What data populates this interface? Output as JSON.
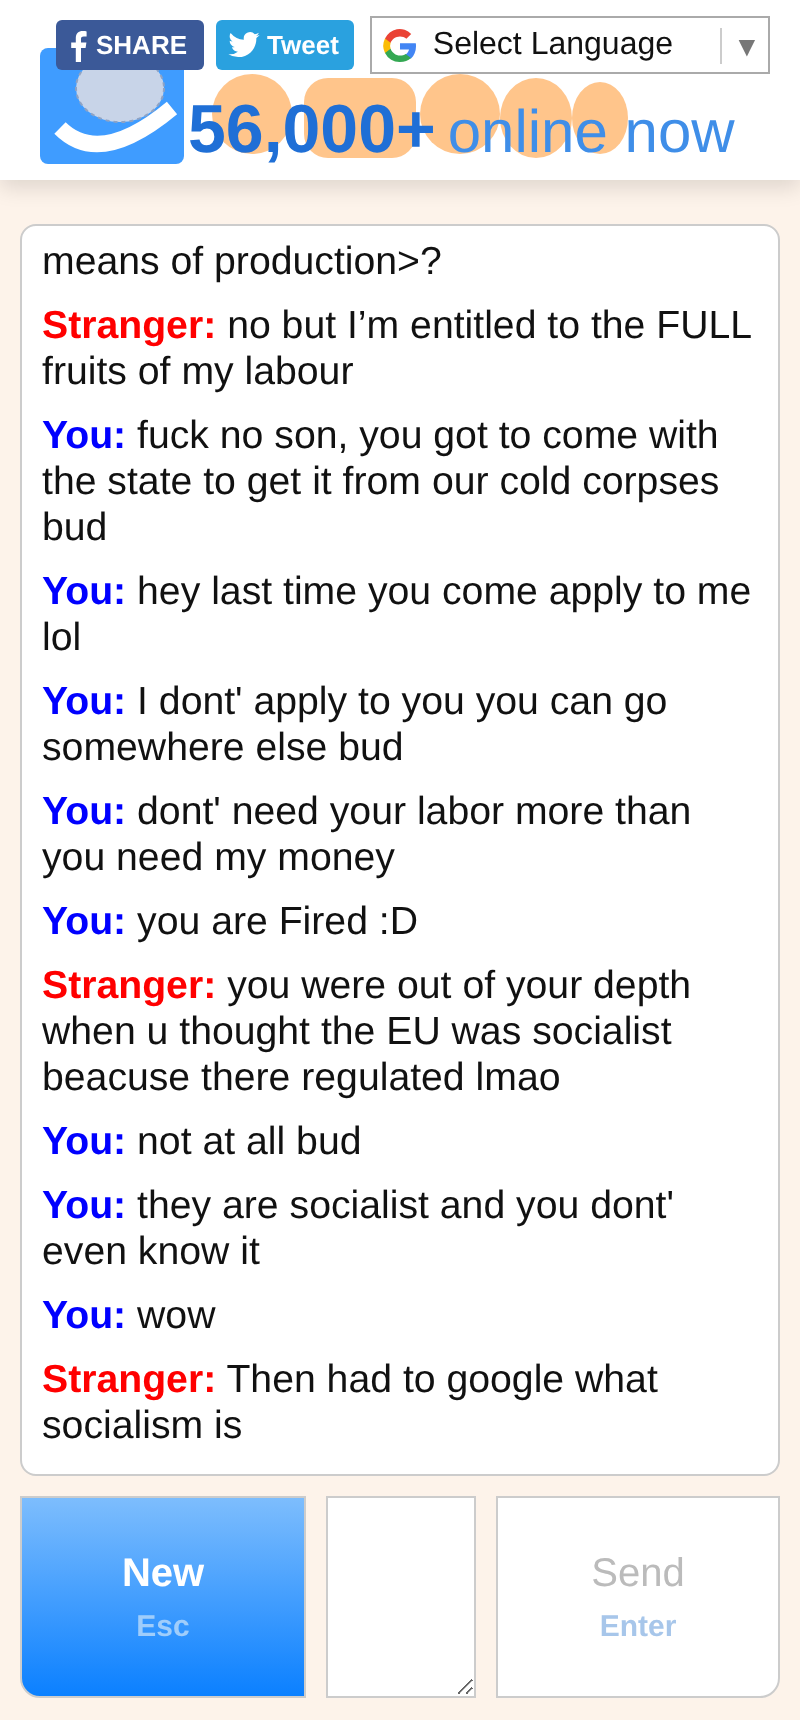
{
  "header": {
    "share_button": "SHARE",
    "tweet_button": "Tweet",
    "language_select": {
      "value": "Select Language",
      "arrow": "▼"
    },
    "online_count": {
      "number": "56,000+",
      "label": "online now"
    }
  },
  "chat": {
    "messages": [
      {
        "kind": "continuation",
        "text": "means of production>?"
      },
      {
        "kind": "stranger",
        "speaker": "Stranger:",
        "text": "no but I’m entitled to the FULL fruits of my labour"
      },
      {
        "kind": "you",
        "speaker": "You:",
        "text": "fuck no son, you got to come with the state to get it from our cold corpses bud"
      },
      {
        "kind": "you",
        "speaker": "You:",
        "text": "hey last time you come apply to me lol"
      },
      {
        "kind": "you",
        "speaker": "You:",
        "text": "I dont' apply to you you can go somewhere else bud"
      },
      {
        "kind": "you",
        "speaker": "You:",
        "text": "dont' need your labor more than you need my money"
      },
      {
        "kind": "you",
        "speaker": "You:",
        "text": "you are Fired :D"
      },
      {
        "kind": "stranger",
        "speaker": "Stranger:",
        "text": "you were out of your depth when u thought the EU was socialist beacuse there regulated lmao"
      },
      {
        "kind": "you",
        "speaker": "You:",
        "text": "not at all bud"
      },
      {
        "kind": "you",
        "speaker": "You:",
        "text": "they are socialist and you dont' even know it"
      },
      {
        "kind": "you",
        "speaker": "You:",
        "text": "wow"
      },
      {
        "kind": "stranger",
        "speaker": "Stranger:",
        "text": "Then had to google what socialism is"
      }
    ]
  },
  "controls": {
    "new_button": {
      "label": "New",
      "key": "Esc",
      "disabled": false
    },
    "send_button": {
      "label": "Send",
      "key": "Enter",
      "disabled": true
    }
  }
}
